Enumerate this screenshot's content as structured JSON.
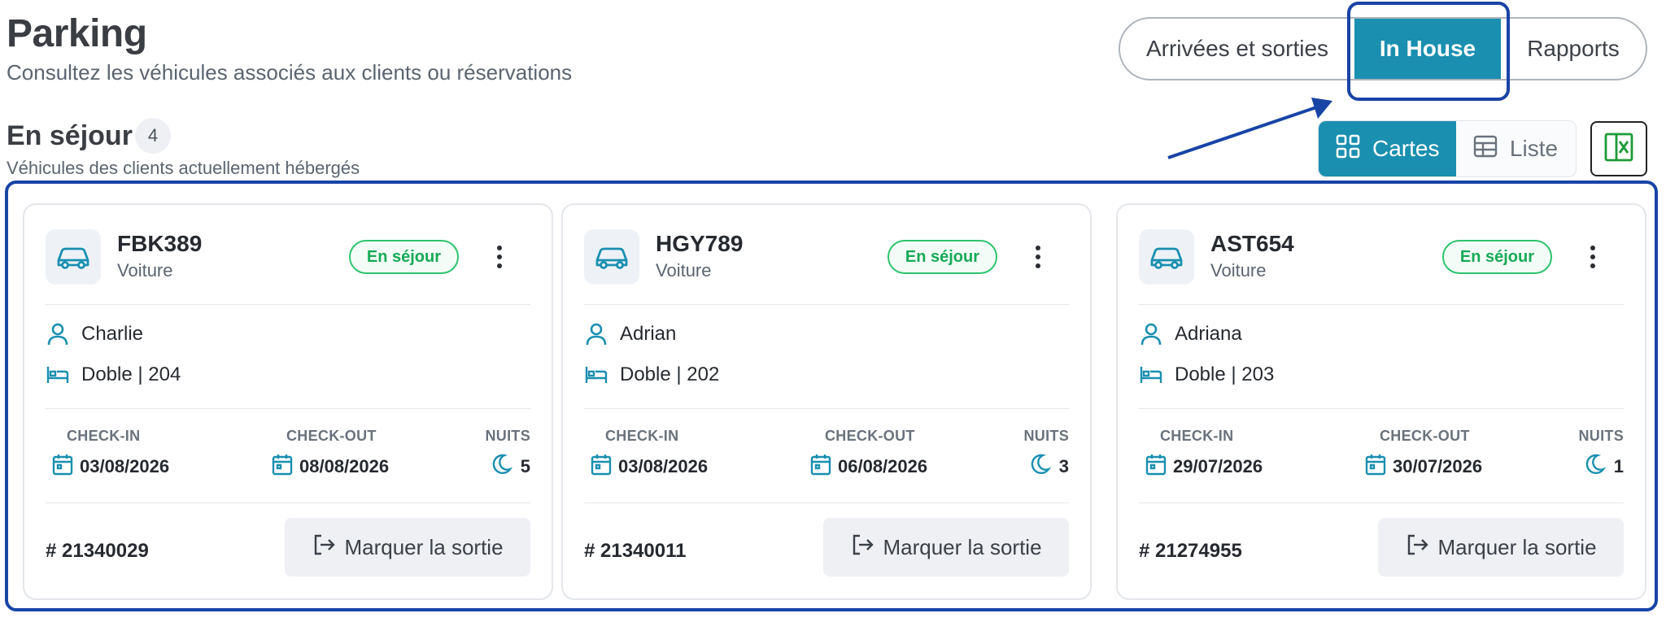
{
  "header": {
    "title": "Parking",
    "subtitle": "Consultez les véhicules associés aux clients ou réservations"
  },
  "tabs": [
    {
      "label": "Arrivées et sorties",
      "active": false
    },
    {
      "label": "In House",
      "active": true
    },
    {
      "label": "Rapports",
      "active": false
    }
  ],
  "section": {
    "title": "En séjour",
    "count": "4",
    "subtitle": "Véhicules des clients actuellement hébergés"
  },
  "view_toggle": {
    "cards_label": "Cartes",
    "list_label": "Liste",
    "selected": "Cartes"
  },
  "colors": {
    "accent": "#1a8fb0",
    "status_green": "#17a957",
    "highlight": "#1844a6"
  },
  "labels": {
    "check_in": "CHECK-IN",
    "check_out": "CHECK-OUT",
    "nights": "NUITS",
    "checkout_action": "Marquer la sortie"
  },
  "cards": [
    {
      "plate": "FBK389",
      "vehicle_type": "Voiture",
      "status": "En séjour",
      "guest": "Charlie",
      "room": "Doble | 204",
      "check_in": "03/08/2026",
      "check_out": "08/08/2026",
      "nights": "5",
      "reservation": "# 21340029"
    },
    {
      "plate": "HGY789",
      "vehicle_type": "Voiture",
      "status": "En séjour",
      "guest": "Adrian",
      "room": "Doble | 202",
      "check_in": "03/08/2026",
      "check_out": "06/08/2026",
      "nights": "3",
      "reservation": "# 21340011"
    },
    {
      "plate": "AST654",
      "vehicle_type": "Voiture",
      "status": "En séjour",
      "guest": "Adriana",
      "room": "Doble | 203",
      "check_in": "29/07/2026",
      "check_out": "30/07/2026",
      "nights": "1",
      "reservation": "# 21274955"
    }
  ]
}
